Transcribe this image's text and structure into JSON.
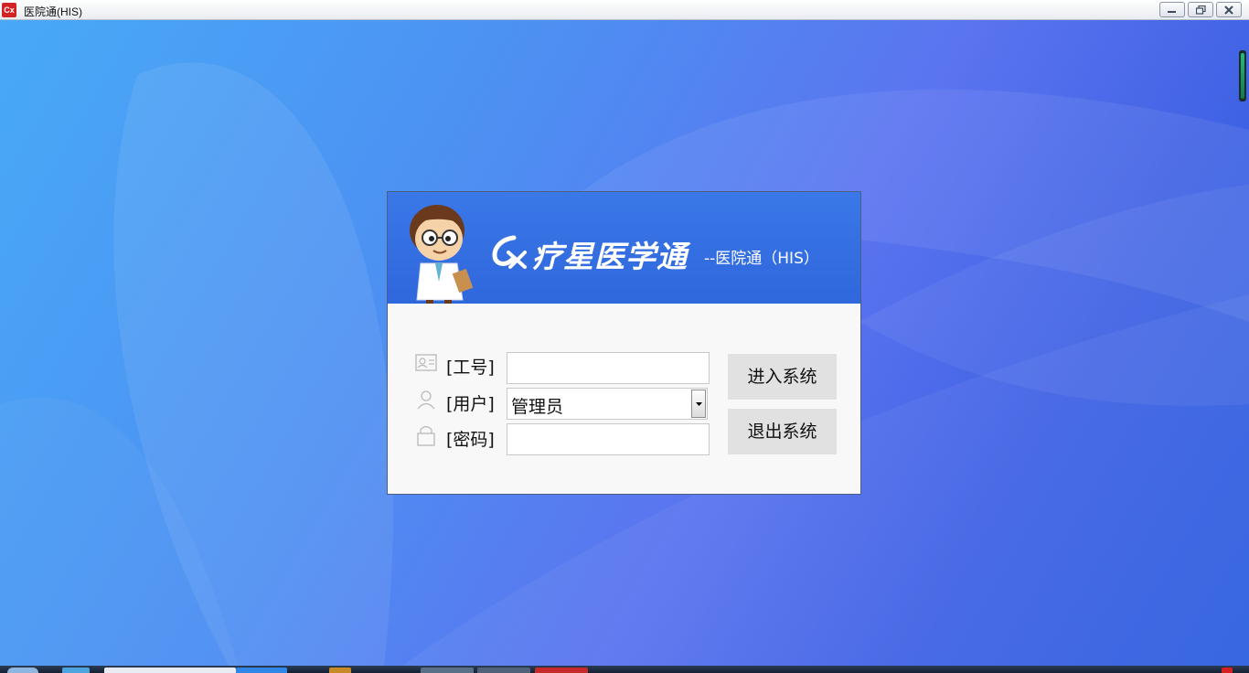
{
  "window": {
    "title": "医院通(HIS)",
    "app_icon": "logo-icon"
  },
  "header": {
    "brand_name": "疗星医学通",
    "brand_subtitle": "--医院通（HIS）"
  },
  "form": {
    "id_label": "[工号]",
    "id_value": "",
    "user_label": "[用户]",
    "user_value": "管理员",
    "password_label": "[密码]",
    "password_value": ""
  },
  "buttons": {
    "login": "进入系统",
    "exit": "退出系统"
  },
  "colors": {
    "header_blue": "#2f67dc",
    "desktop_blue": "#4d8ff2",
    "brand_red": "#d32424"
  }
}
